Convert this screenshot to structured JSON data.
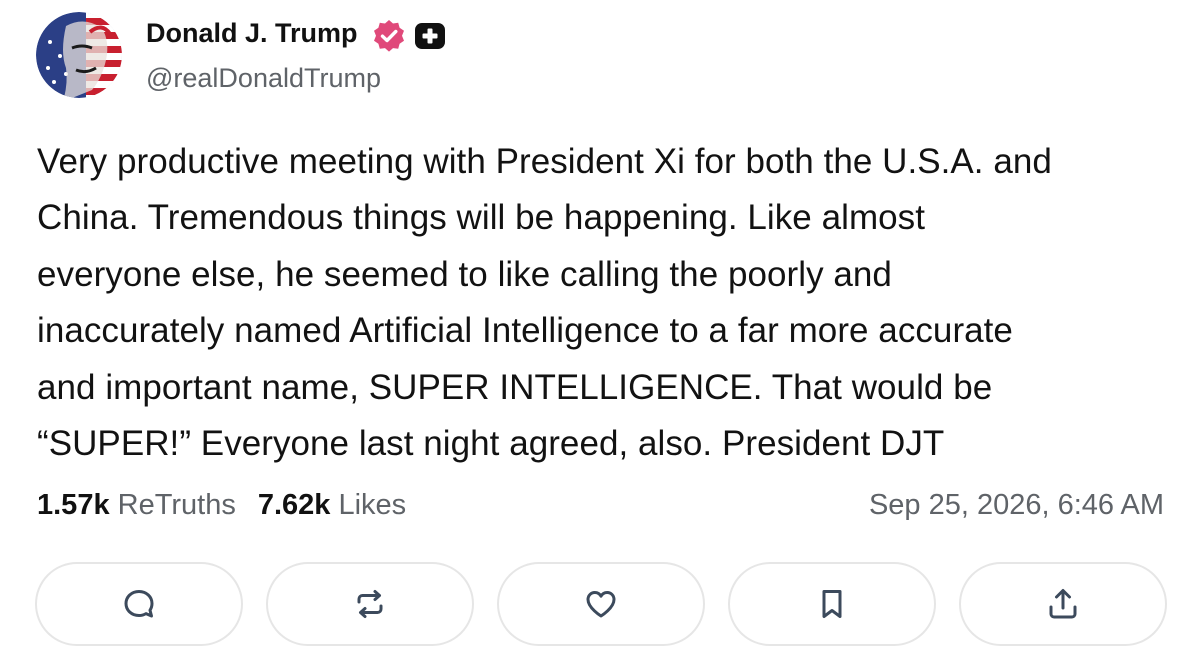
{
  "author": {
    "display_name": "Donald J. Trump",
    "handle": "@realDonaldTrump",
    "verified_badge_color": "#e0497a"
  },
  "post": {
    "lines": [
      "Very productive meeting with President Xi for both the U.S.A. and",
      "China. Tremendous things will be happening. Like almost",
      "everyone else, he seemed to like calling the poorly and",
      "inaccurately named Artificial Intelligence to a far more accurate",
      "and important name, SUPER INTELLIGENCE. That would be",
      "“SUPER!” Everyone last night agreed, also. President DJT"
    ]
  },
  "stats": {
    "retruths_count": "1.57k",
    "retruths_label": "ReTruths",
    "likes_count": "7.62k",
    "likes_label": "Likes",
    "timestamp": "Sep 25, 2026, 6:46 AM"
  },
  "actions": [
    {
      "icon": "reply-icon"
    },
    {
      "icon": "retruth-icon"
    },
    {
      "icon": "like-icon"
    },
    {
      "icon": "bookmark-icon"
    },
    {
      "icon": "share-icon"
    }
  ]
}
